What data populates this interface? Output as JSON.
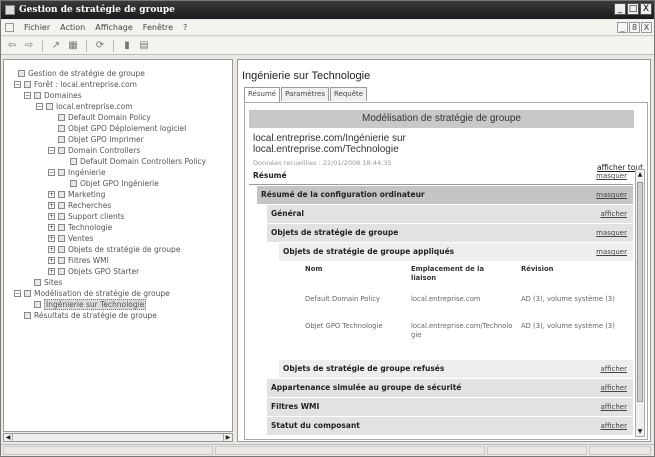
{
  "window": {
    "title": "Gestion de stratégie de groupe",
    "buttons": [
      "_",
      "□",
      "X"
    ]
  },
  "menubar": {
    "items": [
      "Fichier",
      "Action",
      "Affichage",
      "Fenêtre",
      "?"
    ],
    "mdi_buttons": [
      "_",
      "8",
      "X"
    ]
  },
  "tree": [
    {
      "label": "Gestion de stratégie de groupe",
      "level": 0,
      "exp": "",
      "icon": "gpmc-icon"
    },
    {
      "label": "Forêt : local.entreprise.com",
      "level": 1,
      "exp": "−",
      "icon": "forest-icon"
    },
    {
      "label": "Domaines",
      "level": 2,
      "exp": "−",
      "icon": "domains-icon"
    },
    {
      "label": "local.entreprise.com",
      "level": 3,
      "exp": "−",
      "icon": "domain-icon"
    },
    {
      "label": "Default Domain Policy",
      "level": 4,
      "exp": "",
      "icon": "gpo-link-icon"
    },
    {
      "label": "Objet GPO Déploiement logiciel",
      "level": 4,
      "exp": "",
      "icon": "gpo-link-icon"
    },
    {
      "label": "Objet GPO Imprimer",
      "level": 4,
      "exp": "",
      "icon": "gpo-link-icon"
    },
    {
      "label": "Domain Controllers",
      "level": 4,
      "exp": "−",
      "icon": "ou-icon"
    },
    {
      "label": "Default Domain Controllers Policy",
      "level": 5,
      "exp": "",
      "icon": "gpo-link-icon"
    },
    {
      "label": "Ingénierie",
      "level": 4,
      "exp": "−",
      "icon": "ou-icon"
    },
    {
      "label": "Objet GPO Ingénierie",
      "level": 5,
      "exp": "",
      "icon": "gpo-link-icon"
    },
    {
      "label": "Marketing",
      "level": 4,
      "exp": "+",
      "icon": "ou-icon"
    },
    {
      "label": "Recherches",
      "level": 4,
      "exp": "+",
      "icon": "ou-icon"
    },
    {
      "label": "Support clients",
      "level": 4,
      "exp": "+",
      "icon": "ou-icon"
    },
    {
      "label": "Technologie",
      "level": 4,
      "exp": "+",
      "icon": "ou-icon"
    },
    {
      "label": "Ventes",
      "level": 4,
      "exp": "+",
      "icon": "ou-icon"
    },
    {
      "label": "Objets de stratégie de groupe",
      "level": 4,
      "exp": "+",
      "icon": "gpo-folder-icon"
    },
    {
      "label": "Filtres WMI",
      "level": 4,
      "exp": "+",
      "icon": "wmi-folder-icon"
    },
    {
      "label": "Objets GPO Starter",
      "level": 4,
      "exp": "+",
      "icon": "starter-gpo-icon"
    },
    {
      "label": "Sites",
      "level": 2,
      "exp": "",
      "icon": "sites-icon"
    },
    {
      "label": "Modélisation de stratégie de groupe",
      "level": 1,
      "exp": "−",
      "icon": "modeling-icon"
    },
    {
      "label": "Ingénierie sur Technologie",
      "level": 2,
      "exp": "",
      "icon": "modeling-result-icon",
      "selected": true
    },
    {
      "label": "Résultats de stratégie de groupe",
      "level": 1,
      "exp": "",
      "icon": "results-icon"
    }
  ],
  "right": {
    "title": "Ingénierie sur Technologie",
    "tabs": [
      "Résumé",
      "Paramètres",
      "Requête"
    ],
    "header": "Modélisation de stratégie de groupe",
    "heading_line1": "local.entreprise.com/Ingénierie sur",
    "heading_line2": "local.entreprise.com/Technologie",
    "date": "Données recueillies : 22/01/2008 18:44:35",
    "show_all": "afficher tout",
    "sections": {
      "resume": {
        "label": "Résumé",
        "action": "masquer"
      },
      "config": {
        "label": "Résumé de la configuration ordinateur",
        "action": "masquer"
      },
      "general": {
        "label": "Général",
        "action": "afficher"
      },
      "gpo": {
        "label": "Objets de stratégie de groupe",
        "action": "masquer"
      },
      "applied": {
        "label": "Objets de stratégie de groupe appliqués",
        "action": "masquer"
      },
      "refused": {
        "label": "Objets de stratégie de groupe refusés",
        "action": "afficher"
      },
      "security": {
        "label": "Appartenance simulée au groupe de sécurité",
        "action": "afficher"
      },
      "wmi": {
        "label": "Filtres WMI",
        "action": "afficher"
      },
      "status": {
        "label": "Statut du composant",
        "action": "afficher"
      }
    },
    "table": {
      "headers": [
        "Nom",
        "Emplacement de la liaison",
        "Révision"
      ],
      "rows": [
        [
          "Default Domain Policy",
          "local.entreprise.com",
          "AD (3), volume système (3)"
        ],
        [
          "Objet GPO Technologie",
          "local.entreprise.com/Technologie",
          "AD (3), volume système (3)"
        ]
      ]
    }
  }
}
